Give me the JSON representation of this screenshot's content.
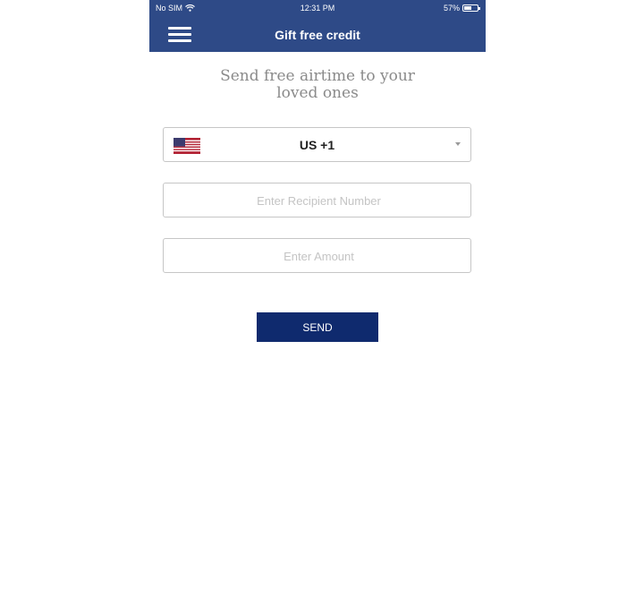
{
  "status_bar": {
    "carrier": "No SIM",
    "time": "12:31 PM",
    "battery_percent": "57%",
    "battery_level": 0.57,
    "wifi_icon": "wifi-icon"
  },
  "navbar": {
    "title": "Gift free credit",
    "menu_icon": "hamburger-menu-icon",
    "background_color": "#2e4a87"
  },
  "form": {
    "heading_line1": "Send free airtime to your",
    "heading_line2": "loved ones",
    "country": {
      "label": "US +1",
      "flag_icon": "us-flag-icon",
      "dropdown_icon": "chevron-down-icon"
    },
    "recipient": {
      "value": "",
      "placeholder": "Enter Recipient Number"
    },
    "amount": {
      "value": "",
      "placeholder": "Enter Amount"
    },
    "send_label": "SEND",
    "send_color": "#0f2a6e"
  }
}
